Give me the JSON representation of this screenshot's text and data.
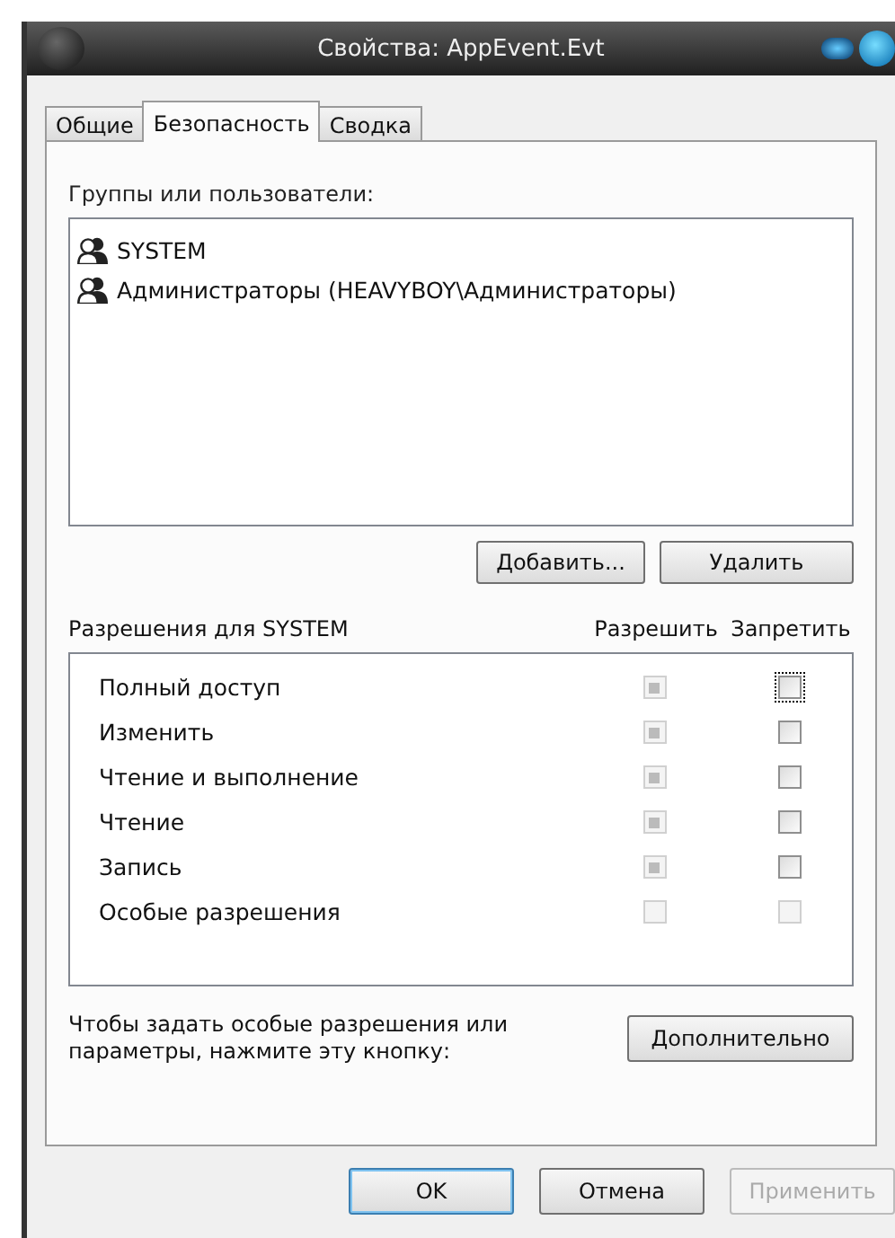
{
  "window": {
    "title": "Свойства: AppEvent.Evt"
  },
  "tabs": [
    {
      "label": "Общие",
      "selected": false
    },
    {
      "label": "Безопасность",
      "selected": true
    },
    {
      "label": "Сводка",
      "selected": false
    }
  ],
  "groups": {
    "label": "Группы или пользователи:",
    "items": [
      {
        "name": "SYSTEM",
        "selected": false
      },
      {
        "name": "Администраторы (HEAVYBOY\\Администраторы)",
        "selected": false
      }
    ]
  },
  "group_buttons": [
    "Добавить...",
    "Удалить"
  ],
  "permissions": {
    "label": "Разрешения для SYSTEM",
    "allow_header": "Разрешить",
    "deny_header": "Запретить",
    "rows": [
      {
        "name": "Полный доступ",
        "allow": {
          "checked": true,
          "disabled": true
        },
        "deny": {
          "checked": false,
          "disabled": false,
          "focused": true
        }
      },
      {
        "name": "Изменить",
        "allow": {
          "checked": true,
          "disabled": true
        },
        "deny": {
          "checked": false,
          "disabled": false,
          "focused": false
        }
      },
      {
        "name": "Чтение и выполнение",
        "allow": {
          "checked": true,
          "disabled": true
        },
        "deny": {
          "checked": false,
          "disabled": false,
          "focused": false
        }
      },
      {
        "name": "Чтение",
        "allow": {
          "checked": true,
          "disabled": true
        },
        "deny": {
          "checked": false,
          "disabled": false,
          "focused": false
        }
      },
      {
        "name": "Запись",
        "allow": {
          "checked": true,
          "disabled": true
        },
        "deny": {
          "checked": false,
          "disabled": false,
          "focused": false
        }
      },
      {
        "name": "Особые разрешения",
        "allow": {
          "checked": false,
          "disabled": true
        },
        "deny": {
          "checked": false,
          "disabled": true,
          "focused": false
        }
      }
    ]
  },
  "advanced": {
    "text": "Чтобы задать особые разрешения или параметры, нажмите эту кнопку:",
    "button": "Дополнительно"
  },
  "footer_buttons": [
    {
      "label": "OK",
      "default": true,
      "disabled": false
    },
    {
      "label": "Отмена",
      "default": false,
      "disabled": false
    },
    {
      "label": "Применить",
      "default": false,
      "disabled": true
    }
  ]
}
